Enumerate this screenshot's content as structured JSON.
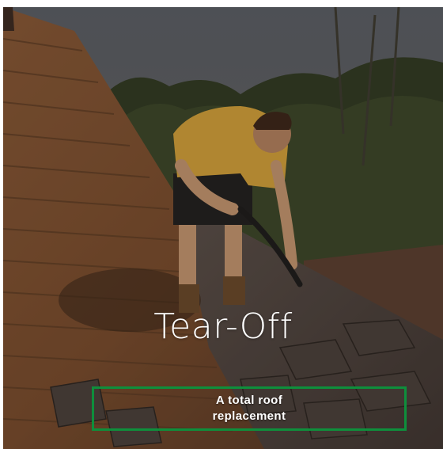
{
  "card": {
    "title": "Tear-Off",
    "cta_label": "A total roof replacement",
    "accent_color": "#0e8f3c"
  },
  "image": {
    "subject": "worker-tearing-off-roof-shingles-icon"
  }
}
